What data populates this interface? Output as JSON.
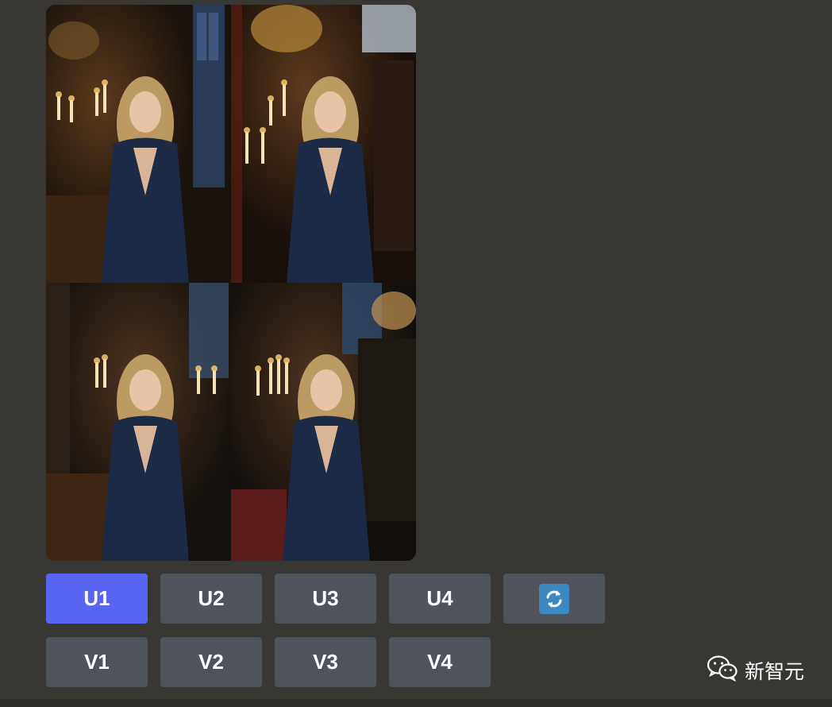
{
  "image_grid": {
    "alt_tiles": [
      "variation-1",
      "variation-2",
      "variation-3",
      "variation-4"
    ]
  },
  "buttons": {
    "upscale": [
      "U1",
      "U2",
      "U3",
      "U4"
    ],
    "variation": [
      "V1",
      "V2",
      "V3",
      "V4"
    ],
    "reroll_icon": "refresh-icon"
  },
  "watermark": {
    "text": "新智元",
    "icon": "wechat-icon"
  },
  "colors": {
    "background": "#393734",
    "button": "#4f545c",
    "button_primary": "#5865f2",
    "reroll_icon_bg": "#3b88c3"
  }
}
